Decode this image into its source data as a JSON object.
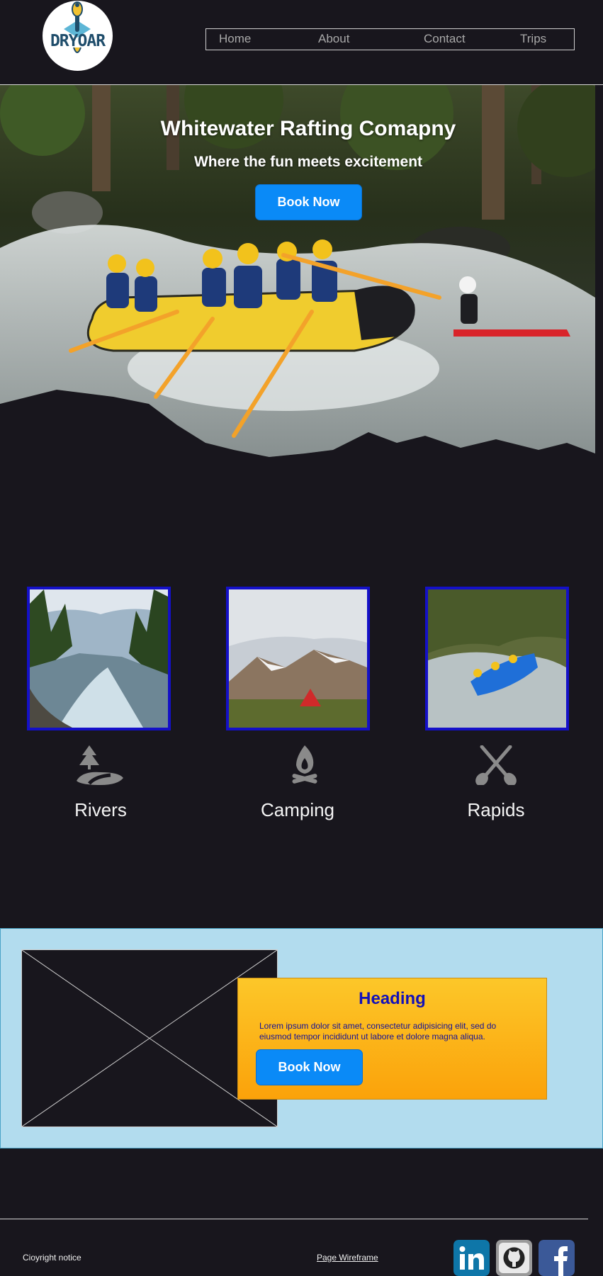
{
  "logo": {
    "text": "DRYOAR"
  },
  "nav": {
    "items": [
      {
        "label": "Home"
      },
      {
        "label": "About"
      },
      {
        "label": "Contact"
      },
      {
        "label": "Trips"
      }
    ]
  },
  "hero": {
    "title": "Whitewater Rafting Comapny",
    "subtitle": "Where the fun meets excitement",
    "button_label": "Book Now"
  },
  "features": [
    {
      "label": "Rivers",
      "icon": "river-trees-icon"
    },
    {
      "label": "Camping",
      "icon": "campfire-icon"
    },
    {
      "label": "Rapids",
      "icon": "crossed-paddles-icon"
    }
  ],
  "promo": {
    "heading": "Heading",
    "text": "Lorem ipsum dolor sit amet, consectetur adipisicing elit, sed do eiusmod tempor incididunt ut labore et dolore magna aliqua.",
    "button_label": "Book Now"
  },
  "footer": {
    "copyright": "Cioyright notice",
    "link_label": "Page Wireframe",
    "social": [
      {
        "name": "LinkedIn",
        "icon": "linkedin-icon"
      },
      {
        "name": "GitHub",
        "icon": "github-icon"
      },
      {
        "name": "Facebook",
        "icon": "facebook-icon"
      }
    ]
  },
  "colors": {
    "background": "#18161d",
    "button": "#0a8af7",
    "promo_band": "#b2dcee",
    "card_gradient_top": "#fcc729",
    "card_gradient_bottom": "#fba20a",
    "heading": "#1412b8",
    "feature_border": "#1410c8"
  }
}
